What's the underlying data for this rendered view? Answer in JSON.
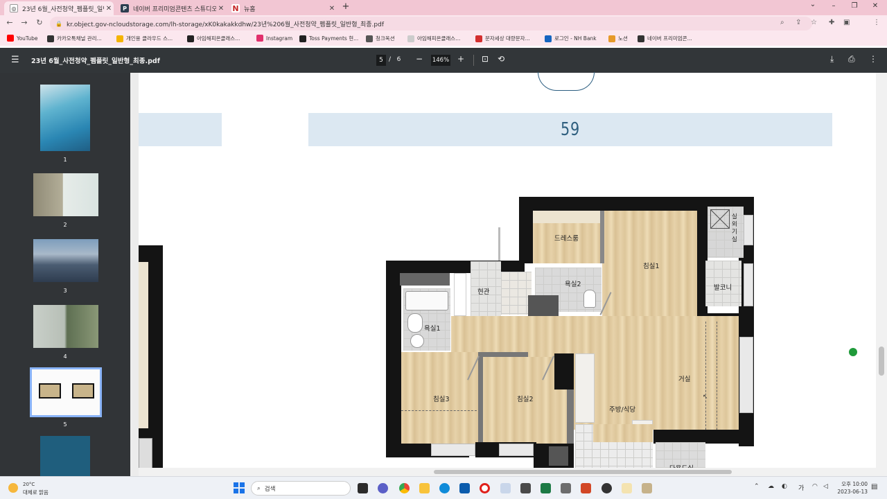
{
  "tabs": [
    {
      "title": "23년 6월_사전청약_펨플릿_일반",
      "active": true
    },
    {
      "title": "네이버 프리미엄콘텐츠 스튜디오",
      "active": false
    },
    {
      "title": "뉴홈",
      "active": false
    }
  ],
  "window_controls": {
    "new_tab": "+",
    "dropdown": "⌄",
    "minimize": "–",
    "restore": "❐",
    "close": "✕"
  },
  "address": {
    "url": "kr.object.gov-ncloudstorage.com/lh-storage/xK0kakakkdhw/23년%206월_사전청약_펨플릿_일반형_최종.pdf"
  },
  "bookmarks": [
    {
      "label": "YouTube",
      "color": "#ff0000"
    },
    {
      "label": "카카오톡채널 관리...",
      "color": "#333333"
    },
    {
      "label": "개인용 클라우드 스...",
      "color": "#f4b400"
    },
    {
      "label": "아임해피온클래스...",
      "color": "#222222"
    },
    {
      "label": "Instagram",
      "color": "#e1306c"
    },
    {
      "label": "Toss Payments 현...",
      "color": "#222222"
    },
    {
      "label": "청크옥션",
      "color": "#555555"
    },
    {
      "label": "아임해피온클래스...",
      "color": "#cccccc"
    },
    {
      "label": "문자세상 대량문자...",
      "color": "#d32f2f"
    },
    {
      "label": "로그인 - NH Bank",
      "color": "#1565c0"
    },
    {
      "label": "노션",
      "color": "#e69a2a"
    },
    {
      "label": "네이버 프리미엄콘...",
      "color": "#333333"
    }
  ],
  "pdf": {
    "filename": "23년 6월_사전청약_펨플릿_일반형_최종.pdf",
    "page_current": "5",
    "page_separator": "/",
    "page_total": "6",
    "zoom": "146%"
  },
  "thumbnails": [
    {
      "number": "1",
      "selected": false
    },
    {
      "number": "2",
      "selected": false
    },
    {
      "number": "3",
      "selected": false
    },
    {
      "number": "4",
      "selected": false
    },
    {
      "number": "5",
      "selected": true
    },
    {
      "number": "",
      "selected": false
    }
  ],
  "floorplan": {
    "size_label": "59",
    "rooms": {
      "dressroom": "드레스룸",
      "bedroom1": "침실1",
      "bathroom2": "욕실2",
      "entrance": "현관",
      "balcony": "발코니",
      "bathroom1": "욕실1",
      "bedroom3": "침실3",
      "bedroom2": "침실2",
      "living": "거실",
      "kitchen": "주방/식당",
      "outdoor_unit": "실외기실",
      "partial_bottom": "다용도실"
    }
  },
  "taskbar": {
    "weather_temp": "20°C",
    "weather_desc": "대체로 맑음",
    "search_placeholder": "검색",
    "time": "오후 10:00",
    "date": "2023-06-13",
    "ime": "가"
  }
}
